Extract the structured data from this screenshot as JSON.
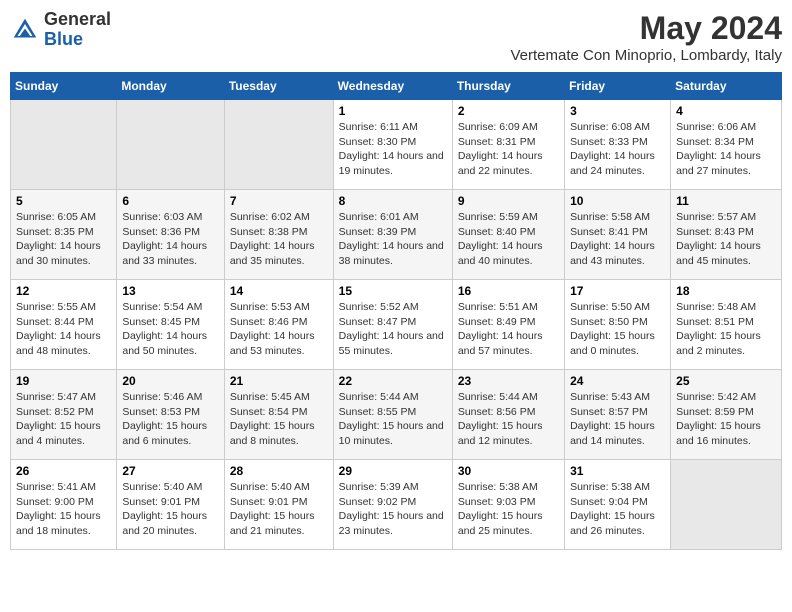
{
  "header": {
    "logo_general": "General",
    "logo_blue": "Blue",
    "month_year": "May 2024",
    "location": "Vertemate Con Minoprio, Lombardy, Italy"
  },
  "days_of_week": [
    "Sunday",
    "Monday",
    "Tuesday",
    "Wednesday",
    "Thursday",
    "Friday",
    "Saturday"
  ],
  "weeks": [
    [
      {
        "num": "",
        "info": ""
      },
      {
        "num": "",
        "info": ""
      },
      {
        "num": "",
        "info": ""
      },
      {
        "num": "1",
        "info": "Sunrise: 6:11 AM\nSunset: 8:30 PM\nDaylight: 14 hours and 19 minutes."
      },
      {
        "num": "2",
        "info": "Sunrise: 6:09 AM\nSunset: 8:31 PM\nDaylight: 14 hours and 22 minutes."
      },
      {
        "num": "3",
        "info": "Sunrise: 6:08 AM\nSunset: 8:33 PM\nDaylight: 14 hours and 24 minutes."
      },
      {
        "num": "4",
        "info": "Sunrise: 6:06 AM\nSunset: 8:34 PM\nDaylight: 14 hours and 27 minutes."
      }
    ],
    [
      {
        "num": "5",
        "info": "Sunrise: 6:05 AM\nSunset: 8:35 PM\nDaylight: 14 hours and 30 minutes."
      },
      {
        "num": "6",
        "info": "Sunrise: 6:03 AM\nSunset: 8:36 PM\nDaylight: 14 hours and 33 minutes."
      },
      {
        "num": "7",
        "info": "Sunrise: 6:02 AM\nSunset: 8:38 PM\nDaylight: 14 hours and 35 minutes."
      },
      {
        "num": "8",
        "info": "Sunrise: 6:01 AM\nSunset: 8:39 PM\nDaylight: 14 hours and 38 minutes."
      },
      {
        "num": "9",
        "info": "Sunrise: 5:59 AM\nSunset: 8:40 PM\nDaylight: 14 hours and 40 minutes."
      },
      {
        "num": "10",
        "info": "Sunrise: 5:58 AM\nSunset: 8:41 PM\nDaylight: 14 hours and 43 minutes."
      },
      {
        "num": "11",
        "info": "Sunrise: 5:57 AM\nSunset: 8:43 PM\nDaylight: 14 hours and 45 minutes."
      }
    ],
    [
      {
        "num": "12",
        "info": "Sunrise: 5:55 AM\nSunset: 8:44 PM\nDaylight: 14 hours and 48 minutes."
      },
      {
        "num": "13",
        "info": "Sunrise: 5:54 AM\nSunset: 8:45 PM\nDaylight: 14 hours and 50 minutes."
      },
      {
        "num": "14",
        "info": "Sunrise: 5:53 AM\nSunset: 8:46 PM\nDaylight: 14 hours and 53 minutes."
      },
      {
        "num": "15",
        "info": "Sunrise: 5:52 AM\nSunset: 8:47 PM\nDaylight: 14 hours and 55 minutes."
      },
      {
        "num": "16",
        "info": "Sunrise: 5:51 AM\nSunset: 8:49 PM\nDaylight: 14 hours and 57 minutes."
      },
      {
        "num": "17",
        "info": "Sunrise: 5:50 AM\nSunset: 8:50 PM\nDaylight: 15 hours and 0 minutes."
      },
      {
        "num": "18",
        "info": "Sunrise: 5:48 AM\nSunset: 8:51 PM\nDaylight: 15 hours and 2 minutes."
      }
    ],
    [
      {
        "num": "19",
        "info": "Sunrise: 5:47 AM\nSunset: 8:52 PM\nDaylight: 15 hours and 4 minutes."
      },
      {
        "num": "20",
        "info": "Sunrise: 5:46 AM\nSunset: 8:53 PM\nDaylight: 15 hours and 6 minutes."
      },
      {
        "num": "21",
        "info": "Sunrise: 5:45 AM\nSunset: 8:54 PM\nDaylight: 15 hours and 8 minutes."
      },
      {
        "num": "22",
        "info": "Sunrise: 5:44 AM\nSunset: 8:55 PM\nDaylight: 15 hours and 10 minutes."
      },
      {
        "num": "23",
        "info": "Sunrise: 5:44 AM\nSunset: 8:56 PM\nDaylight: 15 hours and 12 minutes."
      },
      {
        "num": "24",
        "info": "Sunrise: 5:43 AM\nSunset: 8:57 PM\nDaylight: 15 hours and 14 minutes."
      },
      {
        "num": "25",
        "info": "Sunrise: 5:42 AM\nSunset: 8:59 PM\nDaylight: 15 hours and 16 minutes."
      }
    ],
    [
      {
        "num": "26",
        "info": "Sunrise: 5:41 AM\nSunset: 9:00 PM\nDaylight: 15 hours and 18 minutes."
      },
      {
        "num": "27",
        "info": "Sunrise: 5:40 AM\nSunset: 9:01 PM\nDaylight: 15 hours and 20 minutes."
      },
      {
        "num": "28",
        "info": "Sunrise: 5:40 AM\nSunset: 9:01 PM\nDaylight: 15 hours and 21 minutes."
      },
      {
        "num": "29",
        "info": "Sunrise: 5:39 AM\nSunset: 9:02 PM\nDaylight: 15 hours and 23 minutes."
      },
      {
        "num": "30",
        "info": "Sunrise: 5:38 AM\nSunset: 9:03 PM\nDaylight: 15 hours and 25 minutes."
      },
      {
        "num": "31",
        "info": "Sunrise: 5:38 AM\nSunset: 9:04 PM\nDaylight: 15 hours and 26 minutes."
      },
      {
        "num": "",
        "info": ""
      }
    ]
  ]
}
